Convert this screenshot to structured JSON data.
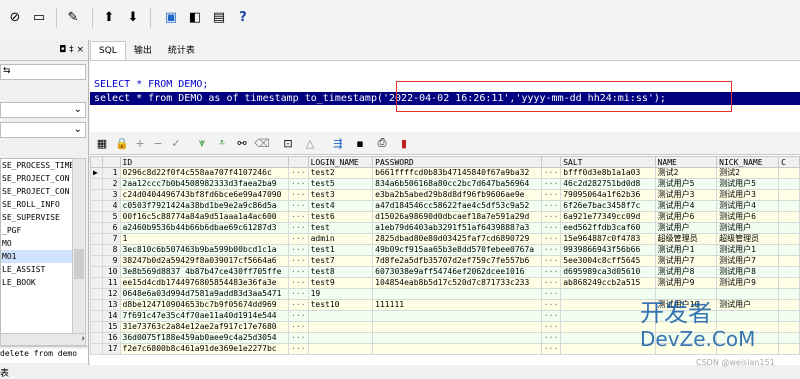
{
  "toolbar": {
    "icons": [
      "pencil-icon",
      "commit-icon",
      "rollback-icon",
      "sql-window-icon",
      "command-window-icon",
      "report-icon",
      "test-icon",
      "help-icon"
    ],
    "help_label": "?"
  },
  "left_panel": {
    "pin_label": "◘ ‡ ×",
    "items": [
      "SE_PROCESS_TIME",
      "SE_PROJECT_CON",
      "SE_PROJECT_CON",
      "SE_ROLL_INFO",
      "SE_SUPERVISE",
      "_PGF",
      "MO",
      "MO1",
      "LE_ASSIST",
      "LE_BOOK"
    ],
    "bottom_tab": "表",
    "bottom_text": "delete from demo"
  },
  "tabs": [
    "SQL",
    "输出",
    "统计表"
  ],
  "editor": {
    "line1_keyword_select": "SELECT",
    "line1_rest": " * FROM DEMO;",
    "line2": "select * from DEMO as of timestamp to_timestamp('2022-04-02 16:26:11','yyyy-mm-dd hh24:mi:ss');"
  },
  "grid": {
    "columns": [
      "",
      "",
      "ID",
      "",
      "LOGIN_NAME",
      "PASSWORD",
      "",
      "SALT",
      "NAME",
      "NICK_NAME",
      ""
    ],
    "rows": [
      {
        "n": "1",
        "id": "0296c8d22f0f4c558aa707f4107246c",
        "login": "test2",
        "pwd": "b661ffffcd0b83b47145840f67a9ba32",
        "salt": "bfff0d3e8b1a1a03",
        "name": "测试2",
        "nick": "测试2",
        "ptr": "▶"
      },
      {
        "n": "2",
        "id": "2aa12ccc7b0b4508982333d3faea2ba9",
        "login": "test5",
        "pwd": "834a6b506168a80cc2bc7d647ba56964",
        "salt": "46c2d282751bd0d8",
        "name": "测试用户5",
        "nick": "测试用户5",
        "ptr": ""
      },
      {
        "n": "3",
        "id": "c24d0404496743bf8fd6bce6e99a47090",
        "login": "test3",
        "pwd": "e3ba2b5abed29b8d8df96fb9606ae9e",
        "salt": "79095064a1f62b36",
        "name": "测试用户3",
        "nick": "测试用户3",
        "ptr": ""
      },
      {
        "n": "4",
        "id": "c0503f7921424a38bd1be9e2a9c86d5a",
        "login": "test4",
        "pwd": "a47d184546cc58622fae4c5df53c9a52",
        "salt": "6f26e7bac3458f7c",
        "name": "测试用户4",
        "nick": "测试用户4",
        "ptr": ""
      },
      {
        "n": "5",
        "id": "00f16c5c88774a84a9d51aaa1a4ac600",
        "login": "test6",
        "pwd": "d15026a98690d0dbcaef18a7e591a29d",
        "salt": "6a921e77349cc09d",
        "name": "测试用户6",
        "nick": "测试用户6",
        "ptr": ""
      },
      {
        "n": "6",
        "id": "a2460b9536b44b66b6dbae69c61287d3",
        "login": "test",
        "pwd": "a1eb79d6403ab3291f51af6439888?a3",
        "salt": "eed562ffdb3caf60",
        "name": "测试用户",
        "nick": "测试用户",
        "ptr": ""
      },
      {
        "n": "7",
        "id": "1",
        "login": "admin",
        "pwd": "2825dbad80e80d03425faf7cd6890729",
        "salt": "15e964887c0f4783",
        "name": "超级管理员",
        "nick": "超级管理员",
        "ptr": ""
      },
      {
        "n": "8",
        "id": "3ec810c6b507463b9ba599b00bcd1c1a",
        "login": "test1",
        "pwd": "49b09cf915aa65b3e8dd570febee0767a",
        "salt": "9939866943f56b66",
        "name": "测试用户1",
        "nick": "测试用户1",
        "ptr": ""
      },
      {
        "n": "9",
        "id": "38247b0d2a59429f8a039017cf5664a6",
        "login": "test7",
        "pwd": "7d8fe2a5dfb35707d2ef759c7fe557b6",
        "salt": "5ee3004c8cff5645",
        "name": "测试用户7",
        "nick": "测试用户7",
        "ptr": ""
      },
      {
        "n": "10",
        "id": "3e8b569d8837 4b87b47ce430ff705ffe",
        "login": "test8",
        "pwd": "6073038e9aff54746ef2062dcee1016",
        "salt": "d695989ca3d05610",
        "name": "测试用户8",
        "nick": "测试用户8",
        "ptr": ""
      },
      {
        "n": "11",
        "id": "ee15d4cdb1744976805854483e36fa3e",
        "login": "test9",
        "pwd": "104854eab8b5d17c520d7c871733c233",
        "salt": "ab868249ccb2a515",
        "name": "测试用户9",
        "nick": "测试用户9",
        "ptr": ""
      },
      {
        "n": "12",
        "id": "0648e6a03d994d7581a9add83d3aa5471",
        "login": "19",
        "pwd": "",
        "salt": "",
        "name": "",
        "nick": "",
        "ptr": ""
      },
      {
        "n": "13",
        "id": "d8be124710904653bc7b9f05674dd969",
        "login": "test10",
        "pwd": "111111",
        "salt": "",
        "name": "测试用户10",
        "nick": "测试用户",
        "ptr": ""
      },
      {
        "n": "14",
        "id": "7f691c47e35c4f70ae11a40d1914e544",
        "login": "",
        "pwd": "",
        "salt": "",
        "name": "",
        "nick": "",
        "ptr": ""
      },
      {
        "n": "15",
        "id": "31e73763c2a84e12ae2af917c17e7680",
        "login": "",
        "pwd": "",
        "salt": "",
        "name": "",
        "nick": "",
        "ptr": ""
      },
      {
        "n": "16",
        "id": "36d0075f188e459ab0aee9c4a25d3054",
        "login": "",
        "pwd": "",
        "salt": "",
        "name": "",
        "nick": "",
        "ptr": ""
      },
      {
        "n": "17",
        "id": "f2e7c6800b8c461a91de369e1e2277bc",
        "login": "",
        "pwd": "",
        "salt": "",
        "name": "",
        "nick": "",
        "ptr": ""
      }
    ],
    "ellipsis": "···"
  },
  "watermark": {
    "line1": "开发者",
    "line2": "DevZe.CoM",
    "csdn": "CSDN @weisian151"
  },
  "colors": {
    "selection": "#000080",
    "highlight_box": "#e03030",
    "keyword": "#0000c8",
    "row_odd": "#ffffe6",
    "row_even": "#f0fff0"
  }
}
